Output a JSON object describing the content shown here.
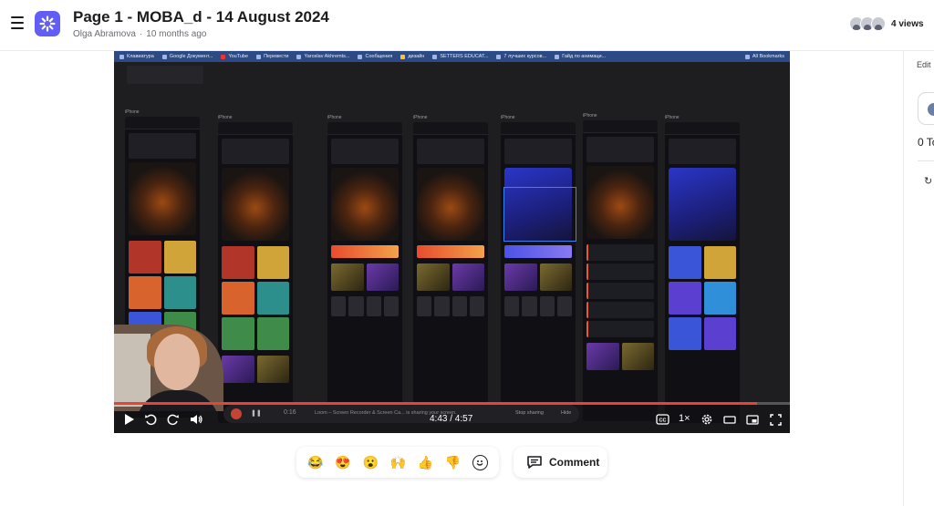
{
  "header": {
    "title": "Page 1 - MOBA_d - 14 August 2024",
    "author": "Olga Abramova",
    "age": "10 months ago",
    "views": "4 views",
    "brand_color": "#625df5"
  },
  "right_panel": {
    "edit_label": "Edit",
    "count_text": "0 To"
  },
  "bookmarks": [
    "Клавиатура",
    "Google Документ...",
    "YouTube",
    "Перевести",
    "Yaroslav Akhremts...",
    "Сообщения",
    "дизайн",
    "SETTERS EDUCAT...",
    "7 лучших курсов...",
    "Гайд по анимаци..."
  ],
  "bookmarks_all": "All Bookmarks",
  "design_canvas": {
    "frame_label": "iPhone"
  },
  "recorder_bar": {
    "time": "0:16",
    "text": "Loom – Screen Recorder & Screen Ca... is sharing your screen.",
    "stop_label": "Stop sharing",
    "hide_label": "Hide"
  },
  "player": {
    "current_time": "4:43",
    "duration": "4:57",
    "time_display": "4:43 / 4:57",
    "progress": 0.952,
    "speed": "1×",
    "progress_color": "#e8433a"
  },
  "reactions": [
    "😂",
    "😍",
    "😮",
    "🙌",
    "👍",
    "👎"
  ],
  "comment_label": "Comment"
}
